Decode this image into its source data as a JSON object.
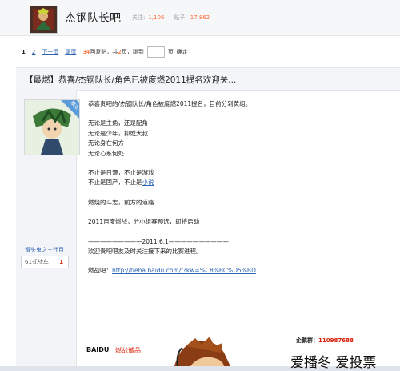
{
  "header": {
    "forum_name": "杰钢队长吧",
    "followers_label": "关注:",
    "followers": "1,106",
    "posts_label": "贴子:",
    "posts": "17,862"
  },
  "pager": {
    "current": "1",
    "page2": "2",
    "next": "下一页",
    "last": "尾页",
    "reply_count": "34",
    "reply_text": "回复贴，共",
    "page_count": "2",
    "page_text": "页，跳到",
    "page_suffix": "页",
    "confirm": "确定"
  },
  "post": {
    "title": "【最燃】恭喜/杰钢队长/角色已被度燃2011提名欢迎关...",
    "badge": "楼主",
    "username": "滑头鬼之三代目",
    "level_name": "61式战车",
    "level": "1",
    "lines": {
      "l1": "恭喜贵吧的/杰钢队长/角色被度燃2011提名，目前分到黄组。",
      "l2": "无论是主角，还是配角",
      "l3": "无论是少年，抑或大叔",
      "l4": "无论身在何方",
      "l5": "无论心系何处",
      "l6": "不止是日漫，不止是游戏",
      "l7a": "不止是国产，不止是",
      "l7b": "小说",
      "l8": "燃烧的斗志，前方的道路",
      "l9": "2011百度燃战，分小组赛预选，即将启动",
      "l10": "—————————2011.6.1——————————",
      "l11": "欢迎贵吧吧友及时关注接下来的比赛进程。",
      "l12a": "燃战吧：",
      "l12b": "http://tieba.baidu.com/f?kw=%C8%BC%D5%BD"
    },
    "banner": {
      "baidu": "BAIDU",
      "slogan": "燃战诚品",
      "qq_label": "企鹅群：",
      "qq": "110987688",
      "big": "爱播冬 爱投票"
    }
  }
}
